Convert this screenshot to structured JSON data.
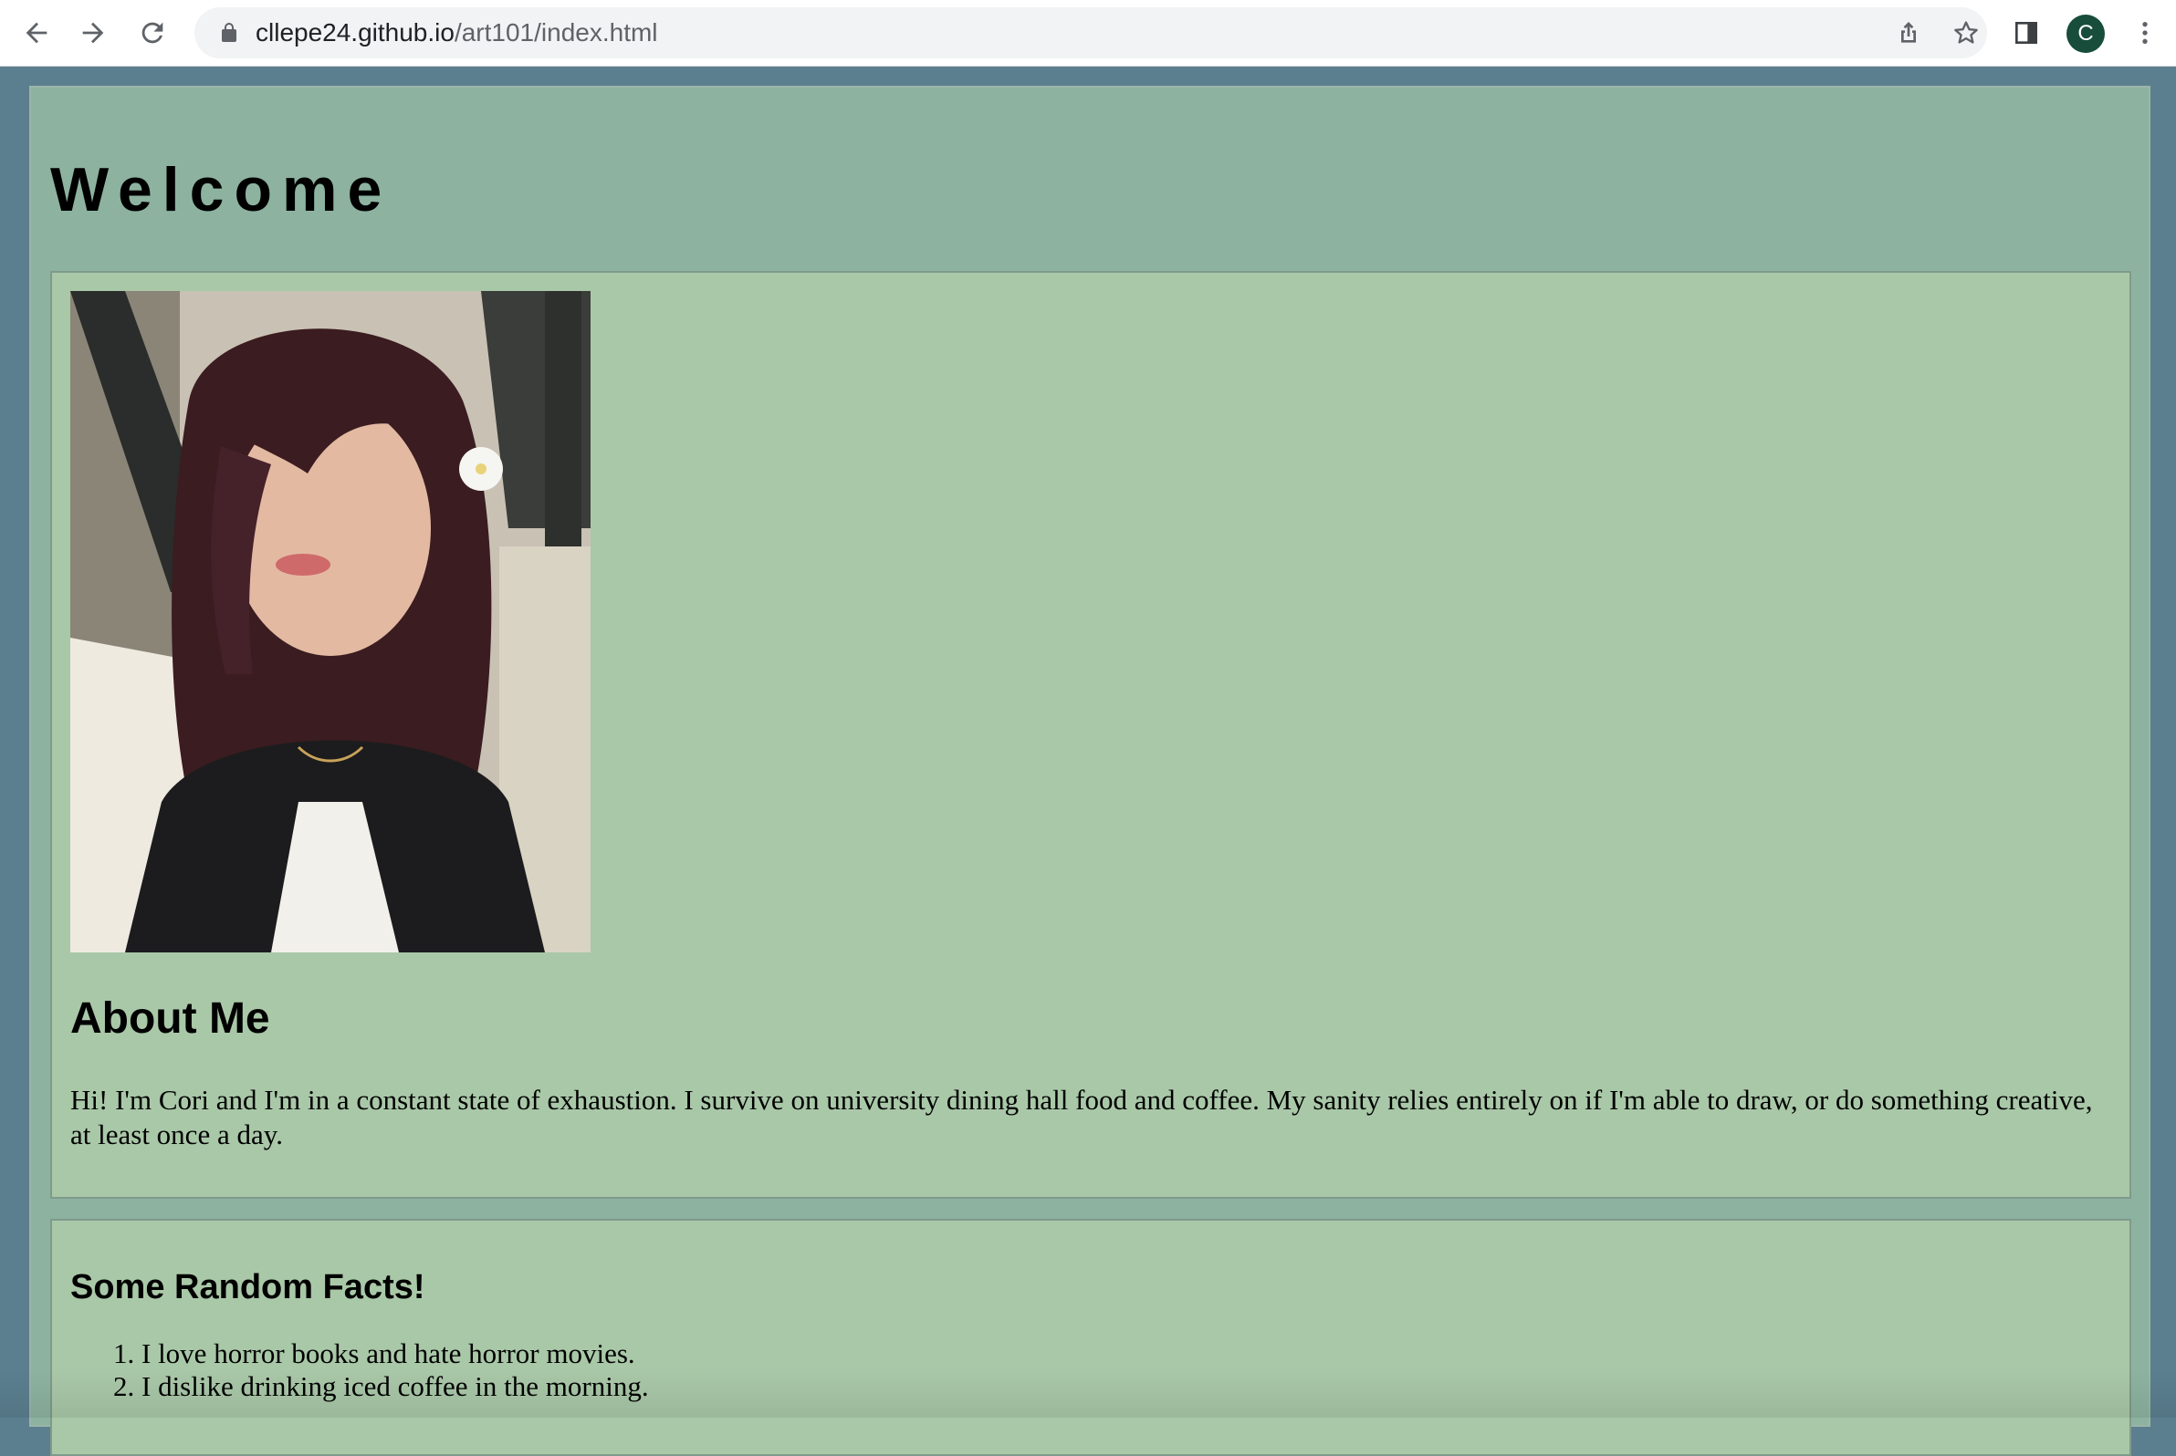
{
  "browser": {
    "url_host": "cllepe24.github.io",
    "url_path": "/art101/index.html",
    "profile_initial": "C",
    "icons": {
      "back": "arrow-left-icon",
      "forward": "arrow-right-icon",
      "reload": "reload-icon",
      "lock": "lock-icon",
      "share": "share-icon",
      "bookmark": "star-icon",
      "side_panel": "side-panel-icon",
      "menu": "kebab-menu-icon"
    }
  },
  "page": {
    "heading": "Welcome",
    "photo_alt": "portrait photo",
    "about": {
      "title": "About Me",
      "text": "Hi! I'm Cori and I'm in a constant state of exhaustion. I survive on university dining hall food and coffee. My sanity relies entirely on if I'm able to draw, or do something creative, at least once a day."
    },
    "facts": {
      "title": "Some Random Facts!",
      "items": [
        "I love horror books and hate horror movies.",
        "I dislike drinking iced coffee in the morning."
      ]
    }
  },
  "colors": {
    "page_background": "#5b7f8f",
    "container_background": "#8db3a0",
    "card_background": "#a9c8a8",
    "profile_avatar": "#174d3a"
  }
}
